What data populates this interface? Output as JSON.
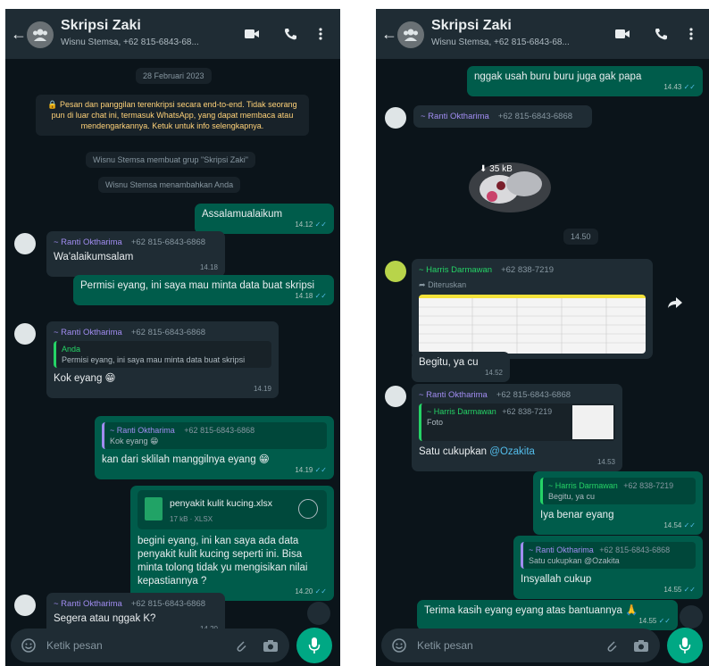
{
  "left": {
    "header": {
      "title": "Skripsi Zaki",
      "subtitle": "Wisnu Stemsa, +62 815-6843-68..."
    },
    "date": "28 Februari 2023",
    "notice": "🔒 Pesan dan panggilan terenkripsi secara end-to-end. Tidak seorang pun di luar chat ini, termasuk WhatsApp, yang dapat membaca atau mendengarkannya. Ketuk untuk info selengkapnya.",
    "system": [
      "Wisnu Stemsa membuat grup \"Skripsi Zaki\"",
      "Wisnu Stemsa menambahkan Anda"
    ],
    "messages": {
      "m1": {
        "text": "Assalamualaikum",
        "time": "14.12"
      },
      "m2": {
        "sender": "~ Ranti Oktharima",
        "number": "+62 815-6843-6868",
        "text": "Wa'alaikumsalam",
        "time": "14.18"
      },
      "m3": {
        "text": "Permisi eyang, ini saya mau minta data buat skripsi",
        "time": "14.18"
      },
      "m4": {
        "sender": "~ Ranti Oktharima",
        "number": "+62 815-6843-6868",
        "quote_sender": "Anda",
        "quote_text": "Permisi eyang, ini saya mau minta data buat skripsi",
        "text": "Kok eyang 😁",
        "time": "14.19"
      },
      "m5": {
        "quote_sender": "~ Ranti Oktharima",
        "quote_number": "+62 815-6843-6868",
        "quote_text": "Kok eyang 😁",
        "text": "kan dari sklilah manggilnya eyang 😁",
        "time": "14.19"
      },
      "m6": {
        "doc_name": "penyakit kulit kucing.xlsx",
        "doc_meta": "17 kB · XLSX",
        "text": "begini eyang, ini kan saya ada data penyakit kulit kucing seperti ini. Bisa minta tolong tidak yu mengisikan nilai kepastiannya ?",
        "time": "14.20"
      },
      "m7": {
        "sender": "~ Ranti Oktharima",
        "number": "+62 815-6843-6868",
        "text": "Segera atau nggak K?",
        "time": "14.20"
      }
    },
    "input": {
      "placeholder": "Ketik pesan"
    }
  },
  "right": {
    "header": {
      "title": "Skripsi Zaki",
      "subtitle": "Wisnu Stemsa, +62 815-6843-68..."
    },
    "messages": {
      "r1": {
        "text": "nggak usah buru buru juga gak papa",
        "time": "14.43"
      },
      "r2": {
        "sender": "~ Ranti Oktharima",
        "number": "+62 815-6843-6868"
      },
      "r3": {
        "image_label": "35 kB",
        "time": "14.50"
      },
      "r4": {
        "sender": "~ Harris Darmawan",
        "number": "+62 838-7219",
        "forwarded": "Diteruskan",
        "text": "Begitu, ya cu",
        "time": "14.52"
      },
      "r5": {
        "sender": "~ Ranti Oktharima",
        "number": "+62 815-6843-6868",
        "quote_sender": "~ Harris Darmawan",
        "quote_number": "+62 838-7219",
        "quote_text": "Foto",
        "text_prefix": "Satu cukupkan ",
        "mention": "@Ozakita",
        "time": "14.53"
      },
      "r6": {
        "quote_sender": "~ Harris Darmawan",
        "quote_number": "+62 838-7219",
        "quote_text": "Begitu, ya cu",
        "text": "Iya benar eyang",
        "time": "14.54"
      },
      "r7": {
        "quote_sender": "~ Ranti Oktharima",
        "quote_number": "+62 815-6843-6868",
        "quote_text": "Satu cukupkan @Ozakita",
        "text": "Insyallah cukup",
        "time": "14.55"
      },
      "r8": {
        "text": "Terima kasih eyang eyang atas bantuannya 🙏",
        "time": "14.55"
      }
    },
    "input": {
      "placeholder": "Ketik pesan"
    }
  },
  "colors": {
    "chat_bg": "#0b141a",
    "header_bg": "#1f2c34",
    "out_bubble": "#005c4b",
    "in_bubble": "#1f2c34",
    "accent": "#00a884",
    "read_ticks": "#53bdeb"
  }
}
